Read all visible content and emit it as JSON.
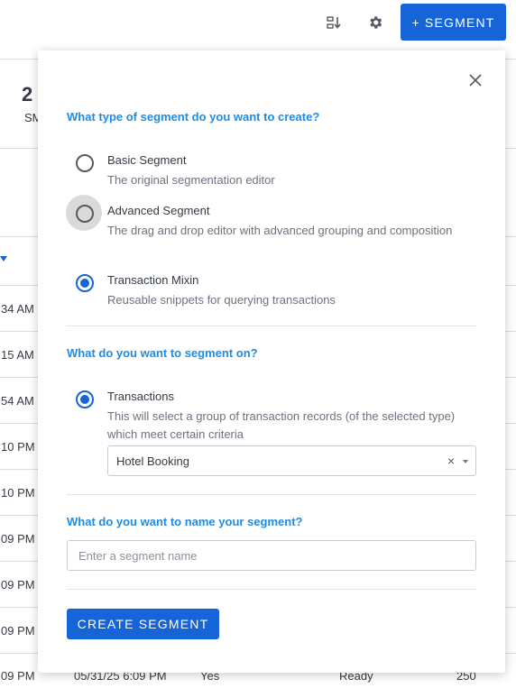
{
  "topbar": {
    "sort_icon": "sort-icon",
    "settings_icon": "gear-icon",
    "segment_button_label": "+ SEGMENT"
  },
  "background": {
    "stat_value": "2",
    "stat_label": "SM",
    "times": [
      "34 AM",
      "15 AM",
      "54 AM",
      "10 PM",
      "10 PM",
      "09 PM",
      "09 PM",
      "09 PM"
    ],
    "last_row": {
      "time": "09 PM",
      "date": "05/31/25 6:09 PM",
      "flag": "Yes",
      "status": "Ready",
      "count": "250"
    }
  },
  "modal": {
    "close_icon": "close-icon",
    "type_question": "What type of segment do you want to create?",
    "segment_types": [
      {
        "label": "Basic Segment",
        "description": "The original segmentation editor",
        "selected": false
      },
      {
        "label": "Advanced Segment",
        "description": "The drag and drop editor with advanced grouping and composition",
        "selected": false
      },
      {
        "label": "Transaction Mixin",
        "description": "Reusable snippets for querying transactions",
        "selected": true
      }
    ],
    "segment_on_question": "What do you want to segment on?",
    "segment_on": {
      "label": "Transactions",
      "description": "This will select a group of transaction records (of the selected type) which meet certain criteria",
      "selected": true
    },
    "transaction_type": {
      "value": "Hotel Booking",
      "clear": "×"
    },
    "name_question": "What do you want to name your segment?",
    "name_input": {
      "placeholder": "Enter a segment name",
      "value": ""
    },
    "create_button_label": "CREATE SEGMENT"
  },
  "colors": {
    "primary": "#1565d8",
    "question": "#1e8ce6",
    "text": "#333a45",
    "muted": "#6b7280"
  }
}
